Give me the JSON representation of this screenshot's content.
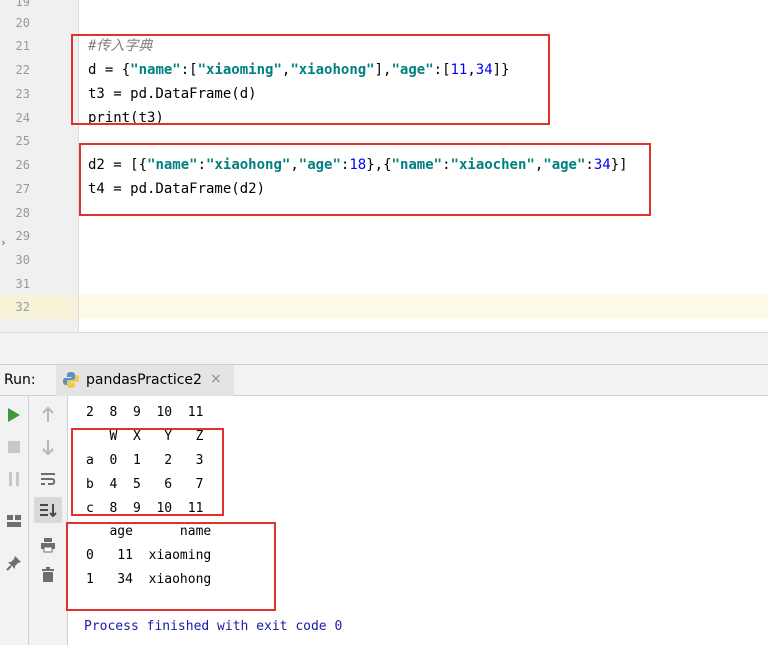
{
  "editor": {
    "line_numbers": [
      "19",
      "20",
      "21",
      "22",
      "23",
      "24",
      "25",
      "26",
      "27",
      "28",
      "29",
      "30",
      "31",
      "32"
    ],
    "comment": "#传入字典",
    "line_d_var": "d = {",
    "key_name": "\"name\"",
    "colon_bracket": ":[",
    "val_xiaoming": "\"xiaoming\"",
    "comma": ",",
    "val_xiaohong": "\"xiaohong\"",
    "close_bracket_comma": "],",
    "key_age": "\"age\"",
    "age_list_open": ":[",
    "num_11": "11",
    "num_34": "34",
    "age_list_close": "]}",
    "line_t3": "t3 = pd.DataFrame(d)",
    "line_print": "print(t3)",
    "line_d2_start": "d2 = [{",
    "d2_colon1": ":",
    "d2_val_xiaohong": "\"xiaohong\"",
    "d2_comma1": ",",
    "d2_key_age1": "\"age\"",
    "d2_colon2": ":",
    "d2_num_18": "18",
    "d2_mid": "},{",
    "d2_key_name2": "\"name\"",
    "d2_colon3": ":",
    "d2_val_xiaochen": "\"xiaochen\"",
    "d2_comma2": ",",
    "d2_key_age2": "\"age\"",
    "d2_colon4": ":",
    "d2_num_34": "34",
    "d2_end": "}]",
    "line_t4": "t4 = pd.DataFrame(d2)"
  },
  "run_panel": {
    "label": "Run:",
    "tab_title": "pandasPractice2",
    "tab_close": "×"
  },
  "console": {
    "lines": [
      "2  8  9  10  11",
      "   W  X   Y   Z",
      "a  0  1   2   3",
      "b  4  5   6   7",
      "c  8  9  10  11",
      "   age      name",
      "0   11  xiaoming",
      "1   34  xiaohong"
    ],
    "finished": "Process finished with exit code 0"
  },
  "colors": {
    "highlight_box": "#e03030",
    "string_teal": "#008080",
    "number_blue": "#0000ff",
    "run_green": "#3c9a3c",
    "exit_text": "#1a1aa6"
  },
  "icons": [
    "python-file-icon",
    "run-icon",
    "stop-icon",
    "pause-icon",
    "up-arrow-icon",
    "down-arrow-icon",
    "soft-wrap-icon",
    "scroll-to-end-icon",
    "print-icon",
    "trash-icon",
    "layout-icon",
    "pin-icon",
    "close-icon",
    "fold-arrow-icon"
  ]
}
